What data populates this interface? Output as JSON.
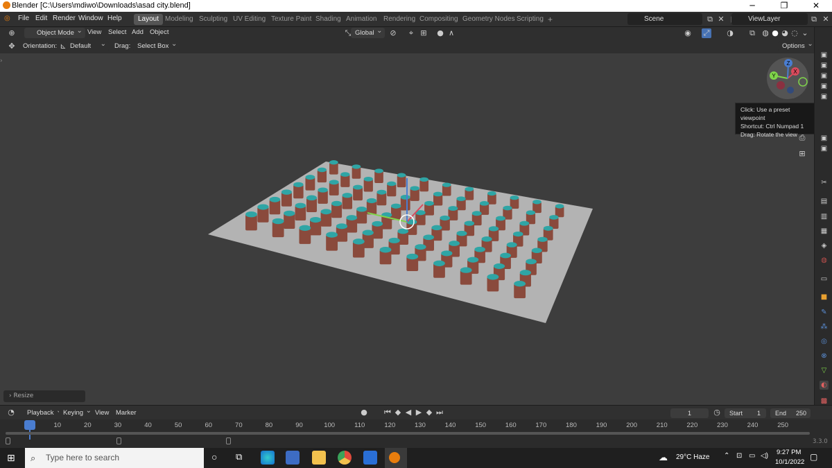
{
  "window": {
    "title": "Blender [C:\\Users\\mdiwo\\Downloads\\asad city.blend]",
    "minimize": "─",
    "maximize": "❐",
    "close": "✕"
  },
  "menu": [
    "File",
    "Edit",
    "Render",
    "Window",
    "Help"
  ],
  "workspaces": [
    "Layout",
    "Modeling",
    "Sculpting",
    "UV Editing",
    "Texture Paint",
    "Shading",
    "Animation",
    "Rendering",
    "Compositing",
    "Geometry Nodes",
    "Scripting",
    "+"
  ],
  "scene": {
    "name": "Scene",
    "view_layer": "ViewLayer"
  },
  "header": {
    "mode": "Object Mode",
    "view": "View",
    "select": "Select",
    "add": "Add",
    "object": "Object",
    "transform": "Global"
  },
  "tool_settings": {
    "orientation_label": "Orientation:",
    "orientation_value": "Default",
    "drag_label": "Drag:",
    "drag_value": "Select Box",
    "options": "Options"
  },
  "tooltip": {
    "line1": "Click: Use a preset viewpoint",
    "line2": "Shortcut: Ctrl Numpad 1",
    "line3": "Drag: Rotate the view"
  },
  "gizmo": {
    "x": "X",
    "y": "Y",
    "z": "Z"
  },
  "last_op": "Resize",
  "timeline": {
    "playback": "Playback",
    "keying": "Keying",
    "view": "View",
    "marker": "Marker",
    "current_frame": "1",
    "start_label": "Start",
    "start": "1",
    "end_label": "End",
    "end": "250",
    "ticks": [
      "1",
      "10",
      "20",
      "30",
      "40",
      "50",
      "60",
      "70",
      "80",
      "90",
      "100",
      "110",
      "120",
      "130",
      "140",
      "150",
      "160",
      "170",
      "180",
      "190",
      "200",
      "210",
      "220",
      "230",
      "240",
      "250"
    ]
  },
  "version": "3.3.0",
  "taskbar": {
    "search_placeholder": "Type here to search",
    "weather": "29°C  Haze",
    "time": "9:27 PM",
    "date": "10/1/2022"
  },
  "colors": {
    "viewport_bg": "#3d3d3d",
    "plane": "#b3b3b3",
    "building_side": "#8a4a3c",
    "building_roof": "#2fa5a5",
    "active_tab": "#555555",
    "frame_marker": "#4a7dd0"
  }
}
